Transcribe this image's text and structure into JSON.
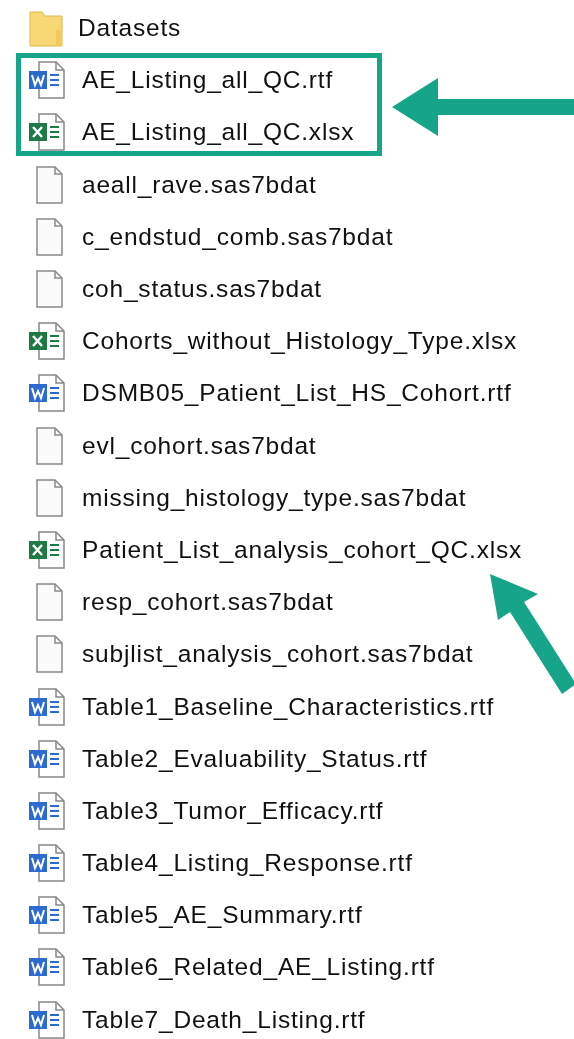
{
  "files": [
    {
      "name": "Datasets",
      "kind": "folder",
      "highlighted": false
    },
    {
      "name": "AE_Listing_all_QC.rtf",
      "kind": "word",
      "highlighted": true
    },
    {
      "name": "AE_Listing_all_QC.xlsx",
      "kind": "excel",
      "highlighted": true
    },
    {
      "name": "aeall_rave.sas7bdat",
      "kind": "blank",
      "highlighted": false
    },
    {
      "name": "c_endstud_comb.sas7bdat",
      "kind": "blank",
      "highlighted": false
    },
    {
      "name": "coh_status.sas7bdat",
      "kind": "blank",
      "highlighted": false
    },
    {
      "name": "Cohorts_without_Histology_Type.xlsx",
      "kind": "excel",
      "highlighted": false
    },
    {
      "name": "DSMB05_Patient_List_HS_Cohort.rtf",
      "kind": "word",
      "highlighted": false
    },
    {
      "name": "evl_cohort.sas7bdat",
      "kind": "blank",
      "highlighted": false
    },
    {
      "name": "missing_histology_type.sas7bdat",
      "kind": "blank",
      "highlighted": false
    },
    {
      "name": "Patient_List_analysis_cohort_QC.xlsx",
      "kind": "excel",
      "highlighted": false
    },
    {
      "name": "resp_cohort.sas7bdat",
      "kind": "blank",
      "highlighted": false
    },
    {
      "name": "subjlist_analysis_cohort.sas7bdat",
      "kind": "blank",
      "highlighted": false
    },
    {
      "name": "Table1_Baseline_Characteristics.rtf",
      "kind": "word",
      "highlighted": false
    },
    {
      "name": "Table2_Evaluability_Status.rtf",
      "kind": "word",
      "highlighted": false
    },
    {
      "name": "Table3_Tumor_Efficacy.rtf",
      "kind": "word",
      "highlighted": false
    },
    {
      "name": "Table4_Listing_Response.rtf",
      "kind": "word",
      "highlighted": false
    },
    {
      "name": "Table5_AE_Summary.rtf",
      "kind": "word",
      "highlighted": false
    },
    {
      "name": "Table6_Related_AE_Listing.rtf",
      "kind": "word",
      "highlighted": false
    },
    {
      "name": "Table7_Death_Listing.rtf",
      "kind": "word",
      "highlighted": false
    }
  ]
}
